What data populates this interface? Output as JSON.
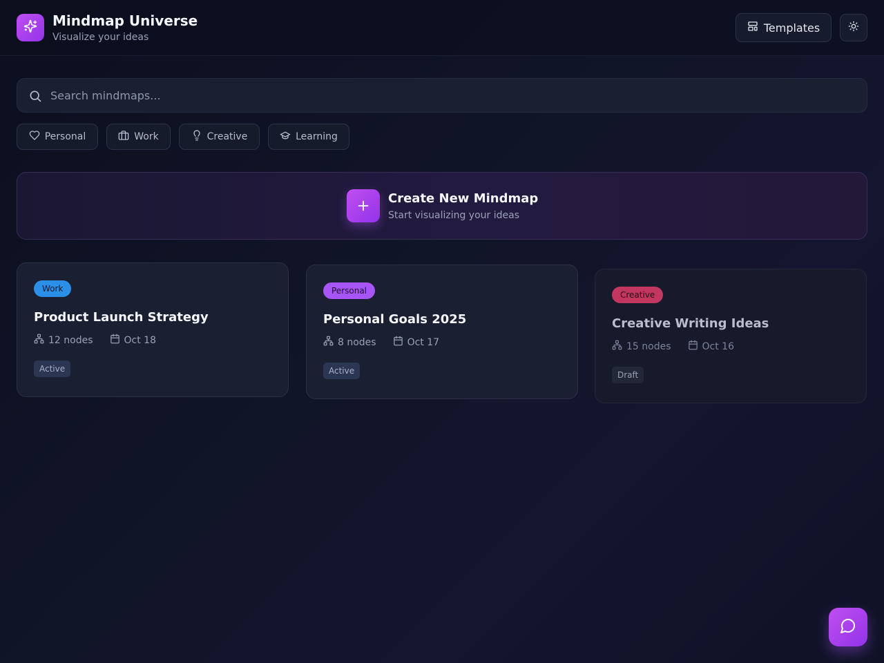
{
  "header": {
    "title": "Mindmap Universe",
    "subtitle": "Visualize your ideas",
    "logo_icon": "sparkles-icon",
    "templates_label": "Templates",
    "theme_icon": "sun-icon"
  },
  "search": {
    "placeholder": "Search mindmaps...",
    "value": ""
  },
  "filters": [
    {
      "label": "Personal",
      "icon": "heart-icon"
    },
    {
      "label": "Work",
      "icon": "briefcase-icon"
    },
    {
      "label": "Creative",
      "icon": "lightbulb-icon"
    },
    {
      "label": "Learning",
      "icon": "graduation-cap-icon"
    }
  ],
  "create": {
    "title": "Create New Mindmap",
    "subtitle": "Start visualizing your ideas"
  },
  "cards": [
    {
      "tag": "Work",
      "tag_color": "#2b8fe8",
      "title": "Product Launch Strategy",
      "nodes": "12 nodes",
      "date": "Oct 18",
      "status": "Active"
    },
    {
      "tag": "Personal",
      "tag_color": "#a855f7",
      "title": "Personal Goals 2025",
      "nodes": "8 nodes",
      "date": "Oct 17",
      "status": "Active"
    },
    {
      "tag": "Creative",
      "tag_color": "#c2375f",
      "title": "Creative Writing Ideas",
      "nodes": "15 nodes",
      "date": "Oct 16",
      "status": "Draft"
    }
  ],
  "colors": {
    "accent": "#a855f7",
    "background": "#0f1226"
  },
  "chat_icon": "message-circle-icon"
}
